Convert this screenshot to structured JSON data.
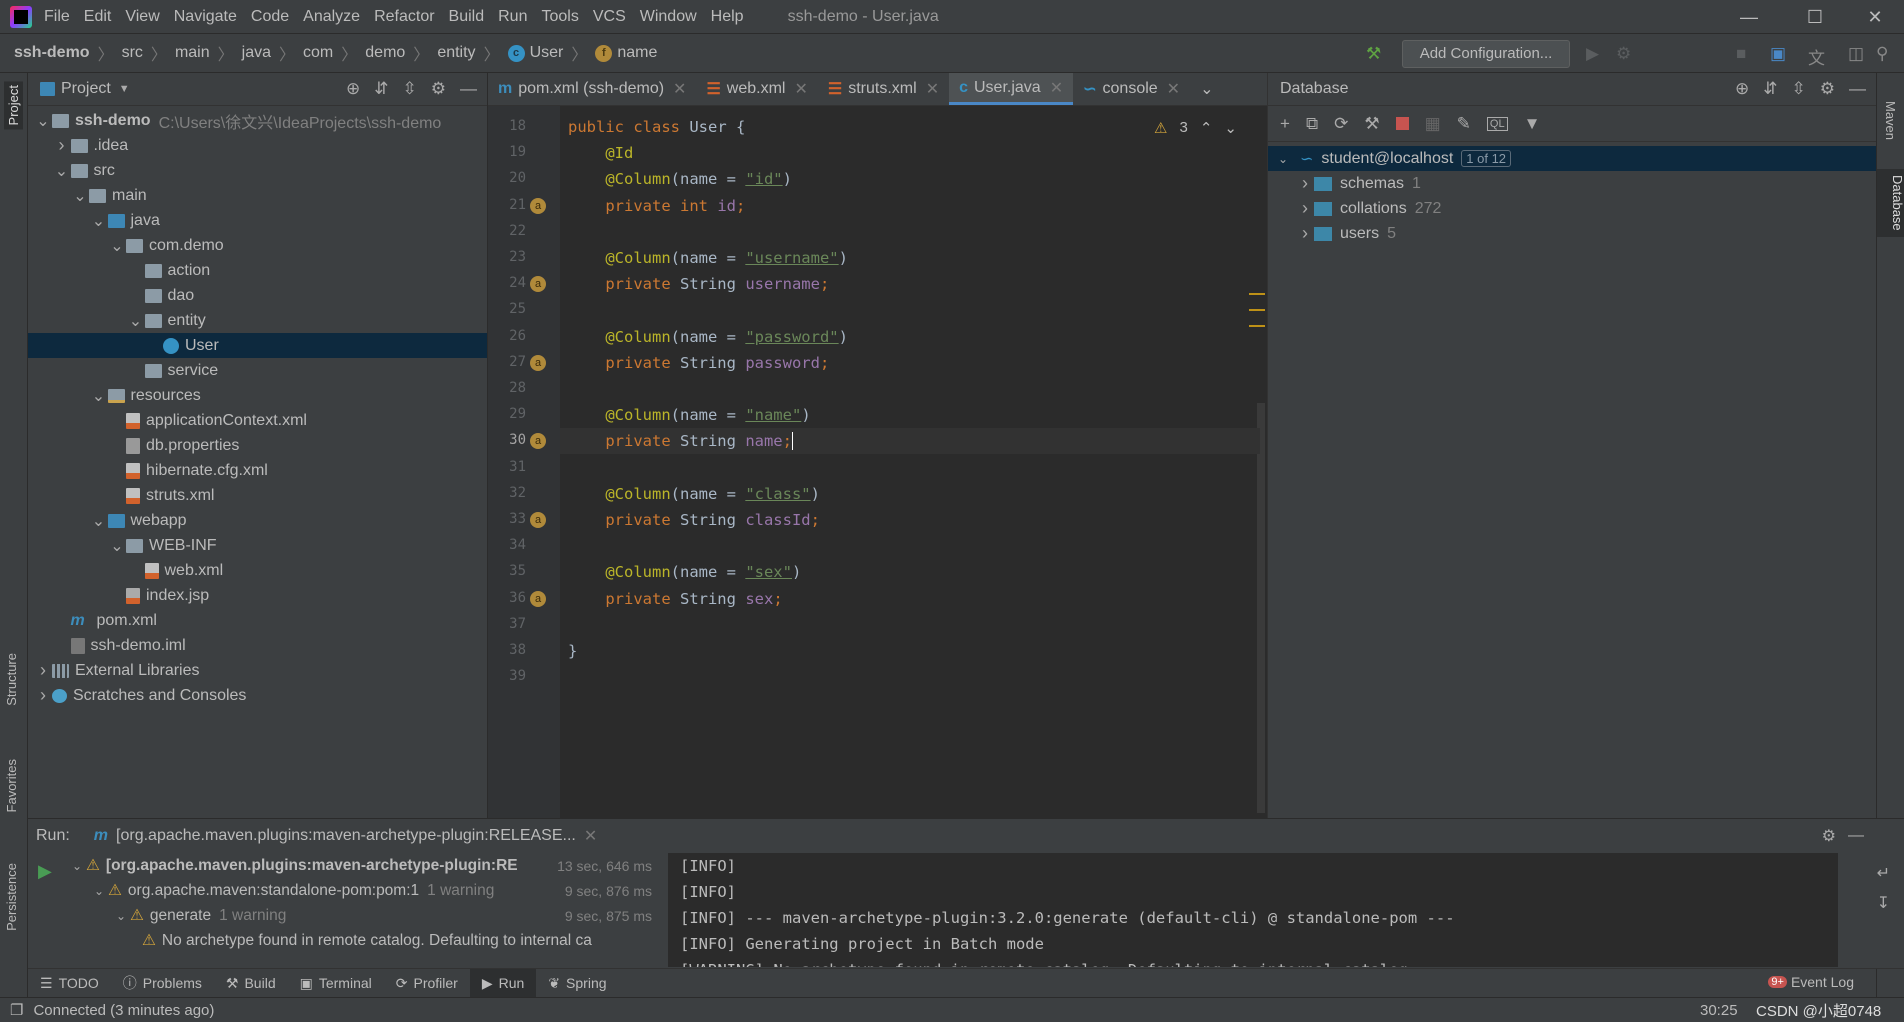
{
  "menu": {
    "items": [
      "File",
      "Edit",
      "View",
      "Navigate",
      "Code",
      "Analyze",
      "Refactor",
      "Build",
      "Run",
      "Tools",
      "VCS",
      "Window",
      "Help"
    ],
    "window_title": "ssh-demo - User.java"
  },
  "breadcrumb": [
    "ssh-demo",
    "src",
    "main",
    "java",
    "com",
    "demo",
    "entity",
    "User",
    "name"
  ],
  "toolbar": {
    "add_configuration": "Add Configuration..."
  },
  "left_strip": {
    "project": "Project",
    "structure": "Structure",
    "favorites": "Favorites",
    "persistence": "Persistence"
  },
  "right_strip": {
    "maven": "Maven",
    "database": "Database"
  },
  "project": {
    "title": "Project",
    "tree": [
      {
        "label": "ssh-demo",
        "hint": "C:\\Users\\徐文兴\\IdeaProjects\\ssh-demo",
        "depth": 0,
        "open": true,
        "icon": "module",
        "bold": true
      },
      {
        "label": ".idea",
        "depth": 1,
        "open": false,
        "icon": "folder"
      },
      {
        "label": "src",
        "depth": 1,
        "open": true,
        "icon": "folder"
      },
      {
        "label": "main",
        "depth": 2,
        "open": true,
        "icon": "folder"
      },
      {
        "label": "java",
        "depth": 3,
        "open": true,
        "icon": "src"
      },
      {
        "label": "com.demo",
        "depth": 4,
        "open": true,
        "icon": "pkg"
      },
      {
        "label": "action",
        "depth": 5,
        "icon": "pkg"
      },
      {
        "label": "dao",
        "depth": 5,
        "icon": "pkg"
      },
      {
        "label": "entity",
        "depth": 5,
        "open": true,
        "icon": "pkg"
      },
      {
        "label": "User",
        "depth": 6,
        "icon": "class",
        "selected": true
      },
      {
        "label": "service",
        "depth": 5,
        "icon": "pkg"
      },
      {
        "label": "resources",
        "depth": 3,
        "open": true,
        "icon": "res"
      },
      {
        "label": "applicationContext.xml",
        "depth": 4,
        "icon": "xml"
      },
      {
        "label": "db.properties",
        "depth": 4,
        "icon": "prop"
      },
      {
        "label": "hibernate.cfg.xml",
        "depth": 4,
        "icon": "xml"
      },
      {
        "label": "struts.xml",
        "depth": 4,
        "icon": "xml"
      },
      {
        "label": "webapp",
        "depth": 3,
        "open": true,
        "icon": "src"
      },
      {
        "label": "WEB-INF",
        "depth": 4,
        "open": true,
        "icon": "folder"
      },
      {
        "label": "web.xml",
        "depth": 5,
        "icon": "xml"
      },
      {
        "label": "index.jsp",
        "depth": 4,
        "icon": "jsp"
      },
      {
        "label": "pom.xml",
        "depth": 1,
        "icon": "maven"
      },
      {
        "label": "ssh-demo.iml",
        "depth": 1,
        "icon": "iml"
      },
      {
        "label": "External Libraries",
        "depth": 0,
        "open": false,
        "icon": "lib"
      },
      {
        "label": "Scratches and Consoles",
        "depth": 0,
        "open": false,
        "icon": "scratch"
      }
    ]
  },
  "editor": {
    "tabs": [
      {
        "label": "pom.xml (ssh-demo)",
        "icon": "maven"
      },
      {
        "label": "web.xml",
        "icon": "xml"
      },
      {
        "label": "struts.xml",
        "icon": "xml"
      },
      {
        "label": "User.java",
        "icon": "class",
        "active": true
      },
      {
        "label": "console",
        "icon": "mysql"
      }
    ],
    "warning_count": "3",
    "current_line": 30,
    "lines": [
      {
        "n": 18,
        "t": [
          [
            "public class ",
            "kw"
          ],
          [
            "User {",
            "pl"
          ]
        ]
      },
      {
        "n": 19,
        "t": [
          [
            "    @Id",
            "an"
          ]
        ]
      },
      {
        "n": 20,
        "t": [
          [
            "    @Column",
            "an"
          ],
          [
            "(name = ",
            "pl"
          ],
          [
            "\"id\"",
            "st"
          ],
          [
            ")",
            "pl"
          ]
        ]
      },
      {
        "n": 21,
        "t": [
          [
            "    private int ",
            "kw"
          ],
          [
            "id",
            "fd"
          ],
          [
            ";",
            "kw"
          ]
        ],
        "mark": true
      },
      {
        "n": 22,
        "t": []
      },
      {
        "n": 23,
        "t": [
          [
            "    @Column",
            "an"
          ],
          [
            "(name = ",
            "pl"
          ],
          [
            "\"username\"",
            "st"
          ],
          [
            ")",
            "pl"
          ]
        ]
      },
      {
        "n": 24,
        "t": [
          [
            "    private ",
            "kw"
          ],
          [
            "String ",
            "pl"
          ],
          [
            "username",
            "fd"
          ],
          [
            ";",
            "kw"
          ]
        ],
        "mark": true
      },
      {
        "n": 25,
        "t": []
      },
      {
        "n": 26,
        "t": [
          [
            "    @Column",
            "an"
          ],
          [
            "(name = ",
            "pl"
          ],
          [
            "\"password\"",
            "st"
          ],
          [
            ")",
            "pl"
          ]
        ]
      },
      {
        "n": 27,
        "t": [
          [
            "    private ",
            "kw"
          ],
          [
            "String ",
            "pl"
          ],
          [
            "password",
            "fd"
          ],
          [
            ";",
            "kw"
          ]
        ],
        "mark": true
      },
      {
        "n": 28,
        "t": []
      },
      {
        "n": 29,
        "t": [
          [
            "    @Column",
            "an"
          ],
          [
            "(name = ",
            "pl"
          ],
          [
            "\"name\"",
            "st"
          ],
          [
            ")",
            "pl"
          ]
        ]
      },
      {
        "n": 30,
        "t": [
          [
            "    private ",
            "kw"
          ],
          [
            "String ",
            "pl"
          ],
          [
            "name",
            "fd"
          ],
          [
            ";",
            "kw"
          ]
        ],
        "mark": true
      },
      {
        "n": 31,
        "t": []
      },
      {
        "n": 32,
        "t": [
          [
            "    @Column",
            "an"
          ],
          [
            "(name = ",
            "pl"
          ],
          [
            "\"class\"",
            "st"
          ],
          [
            ")",
            "pl"
          ]
        ]
      },
      {
        "n": 33,
        "t": [
          [
            "    private ",
            "kw"
          ],
          [
            "String ",
            "pl"
          ],
          [
            "classId",
            "fd"
          ],
          [
            ";",
            "kw"
          ]
        ],
        "mark": true
      },
      {
        "n": 34,
        "t": []
      },
      {
        "n": 35,
        "t": [
          [
            "    @Column",
            "an"
          ],
          [
            "(name = ",
            "pl"
          ],
          [
            "\"sex\"",
            "st"
          ],
          [
            ")",
            "pl"
          ]
        ]
      },
      {
        "n": 36,
        "t": [
          [
            "    private ",
            "kw"
          ],
          [
            "String ",
            "pl"
          ],
          [
            "sex",
            "fd"
          ],
          [
            ";",
            "kw"
          ]
        ],
        "mark": true
      },
      {
        "n": 37,
        "t": []
      },
      {
        "n": 38,
        "t": [
          [
            "}",
            "pl"
          ]
        ]
      },
      {
        "n": 39,
        "t": []
      }
    ]
  },
  "database": {
    "title": "Database",
    "root": {
      "label": "student@localhost",
      "badge": "1 of 12"
    },
    "items": [
      {
        "label": "schemas",
        "count": "1"
      },
      {
        "label": "collations",
        "count": "272"
      },
      {
        "label": "users",
        "count": "5"
      }
    ]
  },
  "run": {
    "label": "Run:",
    "tab": "[org.apache.maven.plugins:maven-archetype-plugin:RELEASE...",
    "tree": [
      {
        "label": "[org.apache.maven.plugins:maven-archetype-plugin:RE",
        "time": "13 sec, 646 ms",
        "depth": 0,
        "bold": true
      },
      {
        "label": "org.apache.maven:standalone-pom:pom:1",
        "hint": "1 warning",
        "time": "9 sec, 876 ms",
        "depth": 1
      },
      {
        "label": "generate",
        "hint": "1 warning",
        "time": "9 sec, 875 ms",
        "depth": 2
      },
      {
        "label": "No archetype found in remote catalog. Defaulting to internal ca",
        "depth": 3,
        "leaf": true
      }
    ],
    "console": [
      "[INFO]",
      "[INFO]",
      "[INFO] --- maven-archetype-plugin:3.2.0:generate (default-cli) @ standalone-pom ---",
      "[INFO] Generating project in Batch mode",
      "[WARNING] No archetype found in remote catalog. Defaulting to internal catalog"
    ]
  },
  "bottom_tabs": [
    "TODO",
    "Problems",
    "Build",
    "Terminal",
    "Profiler",
    "Run",
    "Spring"
  ],
  "event_log": {
    "label": "Event Log",
    "badge": "9+"
  },
  "status": {
    "message": "Connected (3 minutes ago)",
    "position": "30:25",
    "watermark": "CSDN @小超0748"
  }
}
